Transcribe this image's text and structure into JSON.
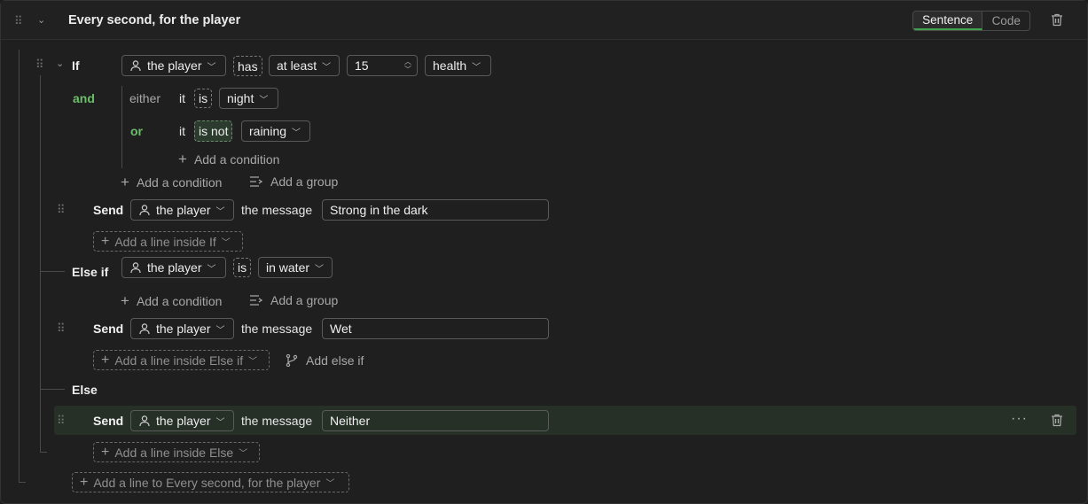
{
  "header": {
    "title": "Every second, for the player",
    "mode_tabs": [
      "Sentence",
      "Code"
    ],
    "active_mode": "Sentence"
  },
  "if_block": {
    "keyword": "If",
    "condition": {
      "target": "the player",
      "verb": "has",
      "comparator": "at least",
      "value": "15",
      "attribute": "health"
    },
    "group": {
      "connector": "and",
      "either_label": "either",
      "or_label": "or",
      "conditions": [
        {
          "subject": "it",
          "verb": "is",
          "value": "night"
        },
        {
          "subject": "it",
          "verb": "is not",
          "value": "raining"
        }
      ],
      "add_condition": "Add a condition"
    },
    "add_condition": "Add a condition",
    "add_group": "Add a group",
    "lines": [
      {
        "action": "Send",
        "target": "the player",
        "connector": "the message",
        "message": "Strong in the dark"
      }
    ],
    "add_line": "Add a line inside If"
  },
  "else_if_block": {
    "keyword": "Else if",
    "condition": {
      "target": "the player",
      "verb": "is",
      "value": "in water"
    },
    "add_condition": "Add a condition",
    "add_group": "Add a group",
    "lines": [
      {
        "action": "Send",
        "target": "the player",
        "connector": "the message",
        "message": "Wet"
      }
    ],
    "add_line": "Add a line inside Else if",
    "add_else_if": "Add else if"
  },
  "else_block": {
    "keyword": "Else",
    "lines": [
      {
        "action": "Send",
        "target": "the player",
        "connector": "the message",
        "message": "Neither"
      }
    ],
    "add_line": "Add a line inside Else"
  },
  "footer": {
    "add_line": "Add a line to Every second, for the player"
  },
  "colors": {
    "accent_green": "#6abf69",
    "highlight_row": "#263027",
    "background": "#1f1f1f"
  },
  "icons": [
    "drag-handle-icon",
    "chevron-down-icon",
    "trash-icon",
    "person-icon",
    "plus-icon",
    "add-group-icon",
    "branch-icon",
    "more-icon"
  ]
}
